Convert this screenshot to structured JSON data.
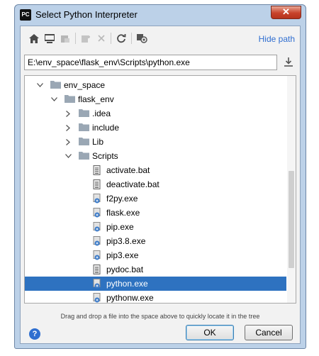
{
  "window": {
    "title": "Select Python Interpreter",
    "app_icon_text": "PC",
    "close_glyph": "✕"
  },
  "toolbar": {
    "icons": [
      "home-icon",
      "desktop-icon",
      "project-folder-icon",
      "module-icon",
      "delete-icon",
      "refresh-icon",
      "show-hidden-icon"
    ],
    "hide_path_label": "Hide path"
  },
  "path": {
    "value": "E:\\env_space\\flask_env\\Scripts\\python.exe"
  },
  "tree": {
    "nodes": [
      {
        "label": "env_space",
        "type": "folder",
        "expanded": true
      },
      {
        "label": "flask_env",
        "type": "folder",
        "expanded": true
      },
      {
        "label": ".idea",
        "type": "folder",
        "expanded": false
      },
      {
        "label": "include",
        "type": "folder",
        "expanded": false
      },
      {
        "label": "Lib",
        "type": "folder",
        "expanded": false
      },
      {
        "label": "Scripts",
        "type": "folder",
        "expanded": true
      },
      {
        "label": "activate.bat",
        "type": "bat"
      },
      {
        "label": "deactivate.bat",
        "type": "bat"
      },
      {
        "label": "f2py.exe",
        "type": "exe"
      },
      {
        "label": "flask.exe",
        "type": "exe"
      },
      {
        "label": "pip.exe",
        "type": "exe"
      },
      {
        "label": "pip3.8.exe",
        "type": "exe"
      },
      {
        "label": "pip3.exe",
        "type": "exe"
      },
      {
        "label": "pydoc.bat",
        "type": "bat"
      },
      {
        "label": "python.exe",
        "type": "exe",
        "selected": true
      },
      {
        "label": "pythonw.exe",
        "type": "exe"
      }
    ]
  },
  "hint": "Drag and drop a file into the space above to quickly locate it in the tree",
  "buttons": {
    "help": "?",
    "ok": "OK",
    "cancel": "Cancel"
  },
  "colors": {
    "selection": "#2e72c0",
    "link": "#2f6ed0",
    "folder": "#9aa7b4"
  }
}
